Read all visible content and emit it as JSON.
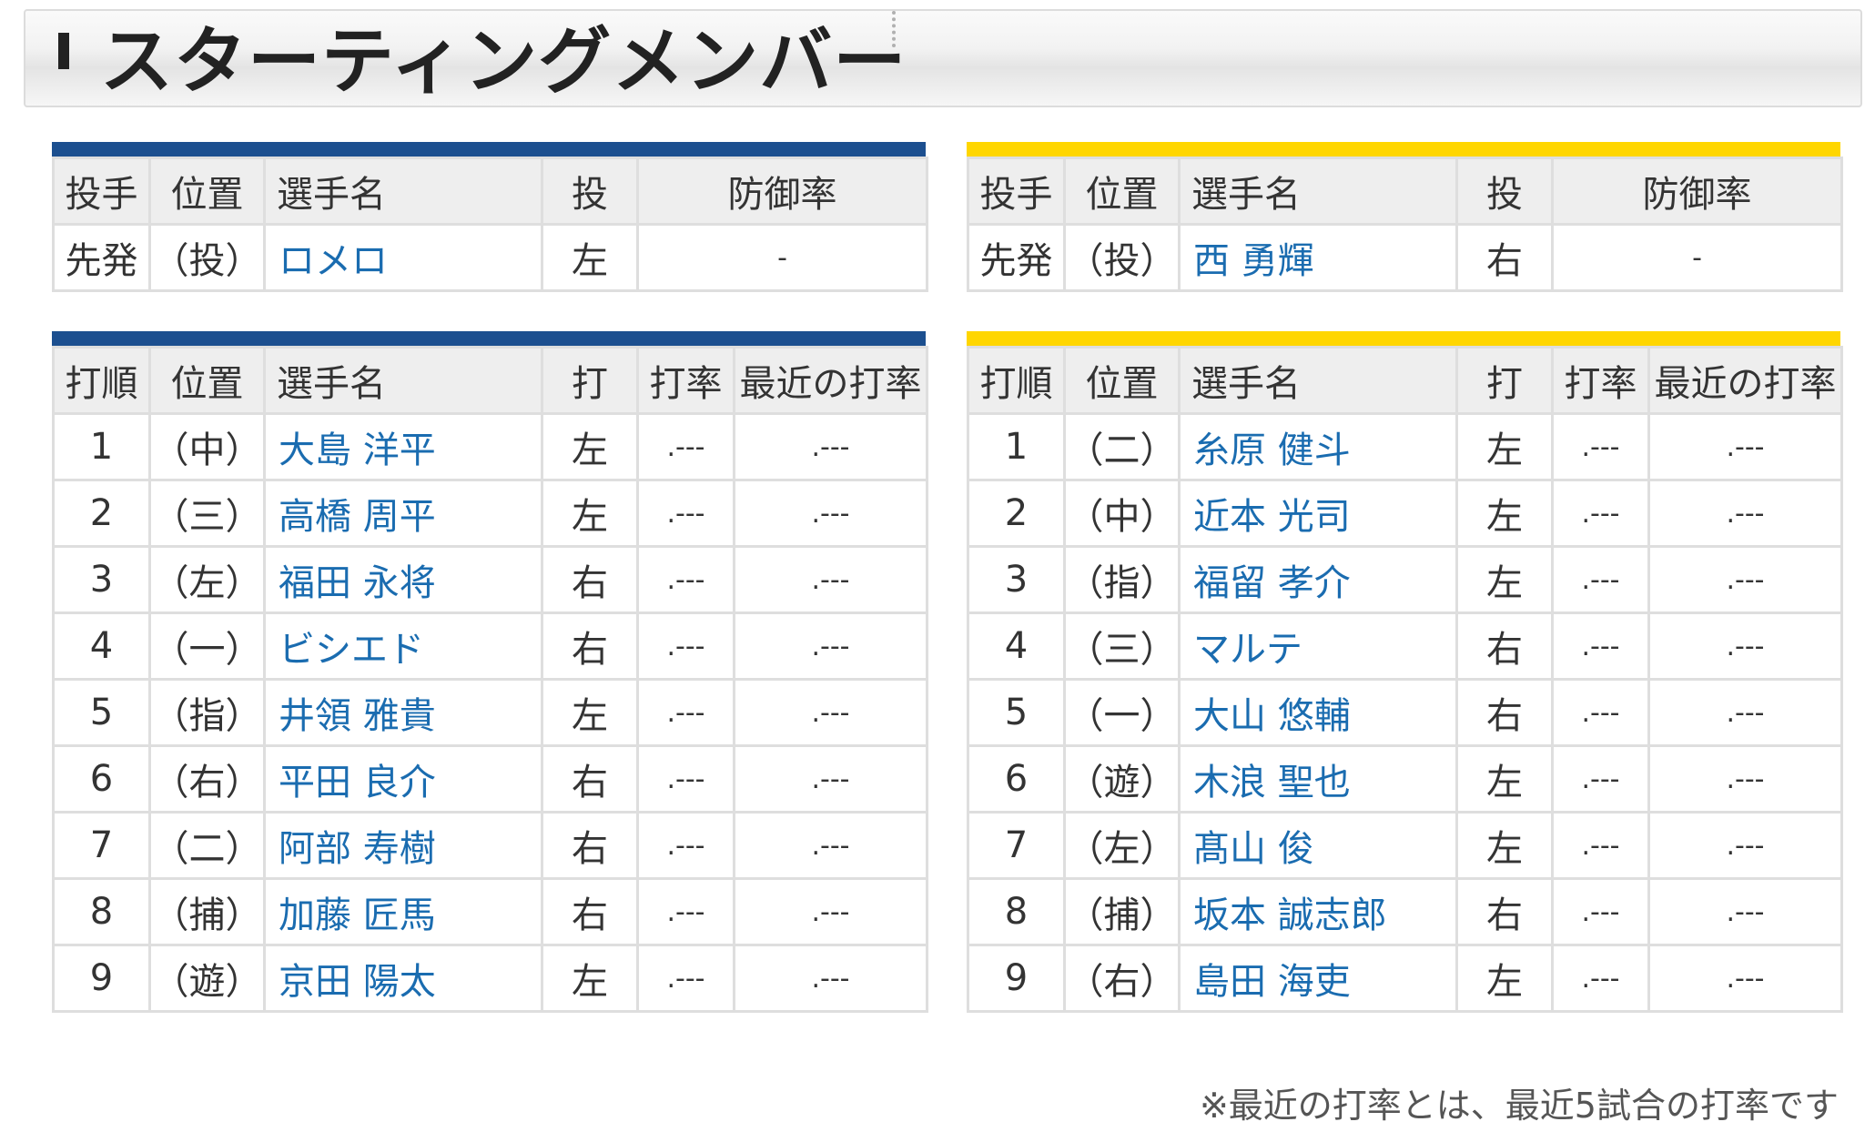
{
  "title": "スターティングメンバー",
  "colors": {
    "home_stripe": "#1c4f8f",
    "away_stripe": "#ffd600",
    "player_link": "#1a6cb0"
  },
  "pitcher_headers": [
    "投手",
    "位置",
    "選手名",
    "投",
    "防御率"
  ],
  "lineup_headers": [
    "打順",
    "位置",
    "選手名",
    "打",
    "打率",
    "最近の打率"
  ],
  "left_team": {
    "pitcher": {
      "role": "先発",
      "pos": "（投）",
      "name": "ロメロ",
      "hand": "左",
      "era": "-"
    },
    "lineup": [
      {
        "order": "1",
        "pos": "（中）",
        "name": "大島 洋平",
        "bat": "左",
        "avg": ".---",
        "recent": ".---"
      },
      {
        "order": "2",
        "pos": "（三）",
        "name": "高橋 周平",
        "bat": "左",
        "avg": ".---",
        "recent": ".---"
      },
      {
        "order": "3",
        "pos": "（左）",
        "name": "福田 永将",
        "bat": "右",
        "avg": ".---",
        "recent": ".---"
      },
      {
        "order": "4",
        "pos": "（一）",
        "name": "ビシエド",
        "bat": "右",
        "avg": ".---",
        "recent": ".---"
      },
      {
        "order": "5",
        "pos": "（指）",
        "name": "井領 雅貴",
        "bat": "左",
        "avg": ".---",
        "recent": ".---"
      },
      {
        "order": "6",
        "pos": "（右）",
        "name": "平田 良介",
        "bat": "右",
        "avg": ".---",
        "recent": ".---"
      },
      {
        "order": "7",
        "pos": "（二）",
        "name": "阿部 寿樹",
        "bat": "右",
        "avg": ".---",
        "recent": ".---"
      },
      {
        "order": "8",
        "pos": "（捕）",
        "name": "加藤 匠馬",
        "bat": "右",
        "avg": ".---",
        "recent": ".---"
      },
      {
        "order": "9",
        "pos": "（遊）",
        "name": "京田 陽太",
        "bat": "左",
        "avg": ".---",
        "recent": ".---"
      }
    ]
  },
  "right_team": {
    "pitcher": {
      "role": "先発",
      "pos": "（投）",
      "name": "西 勇輝",
      "hand": "右",
      "era": "-"
    },
    "lineup": [
      {
        "order": "1",
        "pos": "（二）",
        "name": "糸原 健斗",
        "bat": "左",
        "avg": ".---",
        "recent": ".---"
      },
      {
        "order": "2",
        "pos": "（中）",
        "name": "近本 光司",
        "bat": "左",
        "avg": ".---",
        "recent": ".---"
      },
      {
        "order": "3",
        "pos": "（指）",
        "name": "福留 孝介",
        "bat": "左",
        "avg": ".---",
        "recent": ".---"
      },
      {
        "order": "4",
        "pos": "（三）",
        "name": "マルテ",
        "bat": "右",
        "avg": ".---",
        "recent": ".---"
      },
      {
        "order": "5",
        "pos": "（一）",
        "name": "大山 悠輔",
        "bat": "右",
        "avg": ".---",
        "recent": ".---"
      },
      {
        "order": "6",
        "pos": "（遊）",
        "name": "木浪 聖也",
        "bat": "左",
        "avg": ".---",
        "recent": ".---"
      },
      {
        "order": "7",
        "pos": "（左）",
        "name": "髙山 俊",
        "bat": "左",
        "avg": ".---",
        "recent": ".---"
      },
      {
        "order": "8",
        "pos": "（捕）",
        "name": "坂本 誠志郎",
        "bat": "右",
        "avg": ".---",
        "recent": ".---"
      },
      {
        "order": "9",
        "pos": "（右）",
        "name": "島田 海吏",
        "bat": "左",
        "avg": ".---",
        "recent": ".---"
      }
    ]
  },
  "footnote": "※最近の打率とは、最近5試合の打率です"
}
